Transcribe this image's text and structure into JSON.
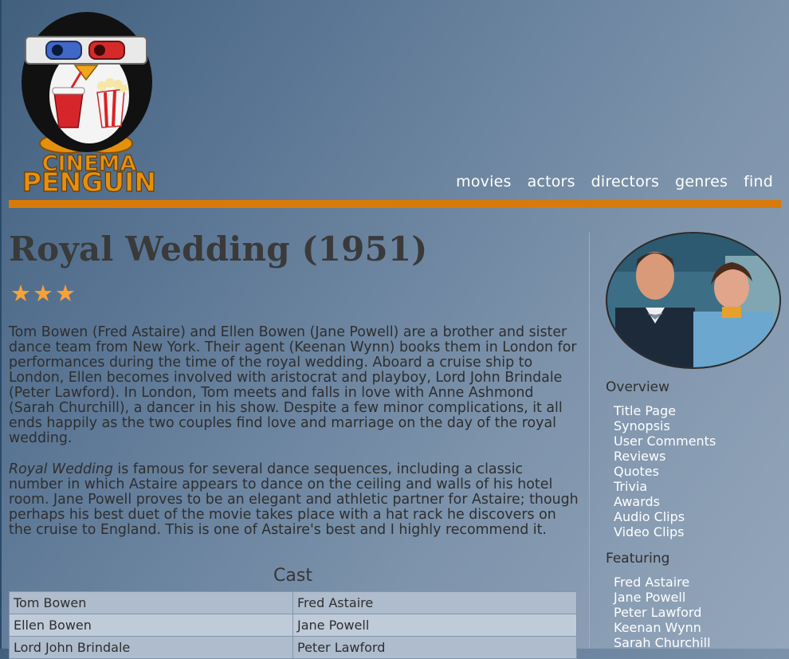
{
  "nav": [
    "movies",
    "actors",
    "directors",
    "genres",
    "find"
  ],
  "logo_text": [
    "CINEMA",
    "PENGUIN"
  ],
  "movie": {
    "title": "Royal Wedding (1951)",
    "rating_stars": 3,
    "stars": "★★★",
    "synopsis": "Tom Bowen (Fred Astaire) and Ellen Bowen (Jane Powell) are a brother and sister dance team from New York. Their agent (Keenan Wynn) books them in London for performances during the time of the royal wedding. Aboard a cruise ship to London, Ellen becomes involved with aristocrat and playboy, Lord John Brindale (Peter Lawford). In London, Tom meets and falls in love with Anne Ashmond (Sarah Churchill), a dancer in his show. Despite a few minor complications, it all ends happily as the two couples find love and marriage on the day of the royal wedding.",
    "review_title_italic": "Royal Wedding",
    "review_rest": " is famous for several dance sequences, including a classic number in which Astaire appears to dance on the ceiling and walls of his hotel room. Jane Powell proves to be an elegant and athletic partner for Astaire; though perhaps his best duet of the movie takes place with a hat rack he discovers on the cruise to England. This is one of Astaire's best and I highly recommend it."
  },
  "cast": {
    "heading": "Cast",
    "rows": [
      [
        "Tom Bowen",
        "Fred Astaire"
      ],
      [
        "Ellen Bowen",
        "Jane Powell"
      ],
      [
        "Lord John Brindale",
        "Peter Lawford"
      ]
    ]
  },
  "sidebar": {
    "overview_heading": "Overview",
    "overview_links": [
      "Title Page",
      "Synopsis",
      "User Comments",
      "Reviews",
      "Quotes",
      "Trivia",
      "Awards",
      "Audio Clips",
      "Video Clips"
    ],
    "featuring_heading": "Featuring",
    "featuring_links": [
      "Fred Astaire",
      "Jane Powell",
      "Peter Lawford",
      "Keenan Wynn",
      "Sarah Churchill"
    ]
  },
  "colors": {
    "accent_orange": "#d87a0a",
    "star": "#f7a236",
    "link": "#ffffff"
  }
}
